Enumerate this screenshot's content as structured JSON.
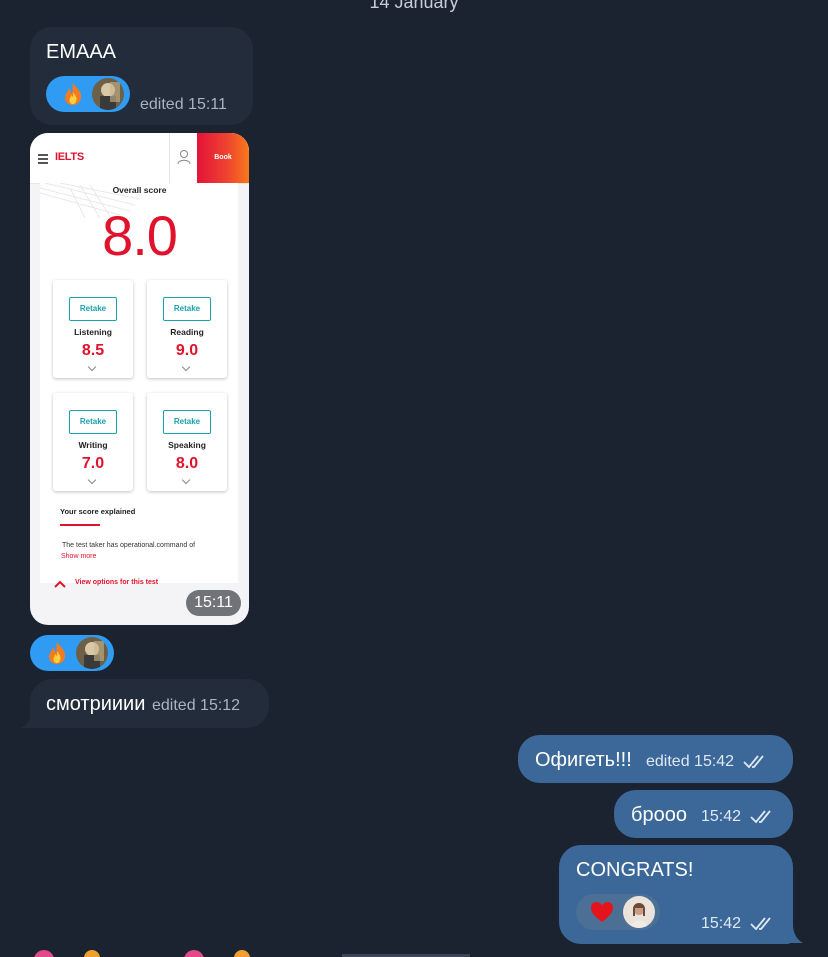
{
  "chat": {
    "date_separator": "14 January",
    "messages": {
      "m1": {
        "text": "ЕМААА",
        "meta": "edited 15:11"
      },
      "photo": {
        "time": "15:11"
      },
      "m3": {
        "text": "смотрииии",
        "meta": "edited 15:12"
      },
      "m4": {
        "text": "Офигеть!!!",
        "meta": "edited 15:42"
      },
      "m5": {
        "text": "брооо",
        "meta": "15:42"
      },
      "m6": {
        "text": "CONGRATS!",
        "meta": "15:42"
      }
    },
    "reactions": {
      "fire": "🔥",
      "heart": "❤"
    }
  },
  "ielts": {
    "logo": "IELTS",
    "book_label": "Book",
    "overall_label": "Overall score",
    "overall_score": "8.0",
    "retake_label": "Retake",
    "tiles": [
      {
        "name": "Listening",
        "score": "8.5"
      },
      {
        "name": "Reading",
        "score": "9.0"
      },
      {
        "name": "Writing",
        "score": "7.0"
      },
      {
        "name": "Speaking",
        "score": "8.0"
      }
    ],
    "explained_title": "Your score explained",
    "explained_text": "The test taker has operational.command of",
    "show_more": "Show more",
    "view_options": "View options for this test"
  },
  "colors": {
    "background": "#1b2330",
    "incoming": "#222c3a",
    "outgoing": "#3b6899",
    "ielts_red": "#e0122c",
    "teal": "#17a2ad"
  }
}
